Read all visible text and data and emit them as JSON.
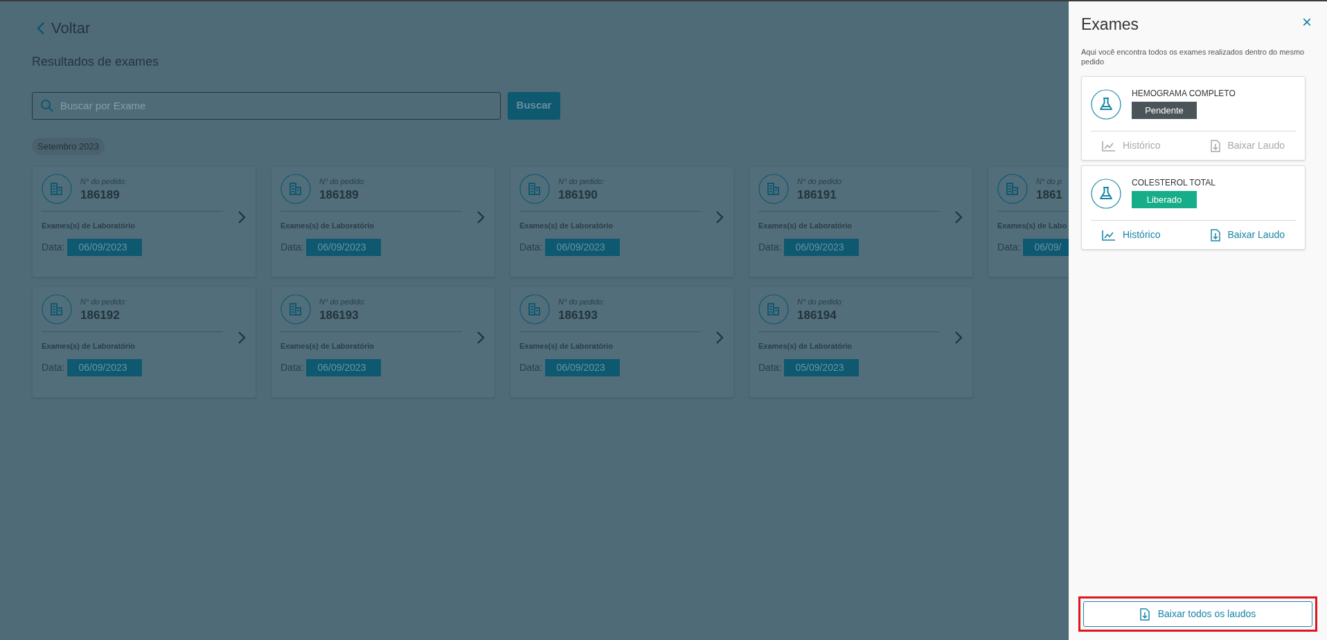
{
  "back_link": {
    "label": "Voltar"
  },
  "page_title": "Resultados de exames",
  "search": {
    "placeholder": "Buscar por Exame",
    "button": "Buscar"
  },
  "month_chip": "Setembro 2023",
  "orders": [
    {
      "number_label": "N° do pedido:",
      "number": "186189",
      "type": "Exames(s) de Laboratório",
      "date_label": "Data:",
      "date": "06/09/2023"
    },
    {
      "number_label": "N° do pedido:",
      "number": "186189",
      "type": "Exames(s) de Laboratório",
      "date_label": "Data:",
      "date": "06/09/2023"
    },
    {
      "number_label": "N° do pedido:",
      "number": "186190",
      "type": "Exames(s) de Laboratório",
      "date_label": "Data:",
      "date": "06/09/2023"
    },
    {
      "number_label": "N° do pedido:",
      "number": "186191",
      "type": "Exames(s) de Laboratório",
      "date_label": "Data:",
      "date": "06/09/2023"
    },
    {
      "number_label": "N° do p",
      "number": "1861",
      "type": "Exames(s) de Labo",
      "date_label": "Data:",
      "date": "06/09/"
    },
    {
      "number_label": "N° do pedido:",
      "number": "186192",
      "type": "Exames(s) de Laboratório",
      "date_label": "Data:",
      "date": "06/09/2023"
    },
    {
      "number_label": "N° do pedido:",
      "number": "186193",
      "type": "Exames(s) de Laboratório",
      "date_label": "Data:",
      "date": "06/09/2023"
    },
    {
      "number_label": "N° do pedido:",
      "number": "186193",
      "type": "Exames(s) de Laboratório",
      "date_label": "Data:",
      "date": "06/09/2023"
    },
    {
      "number_label": "N° do pedido:",
      "number": "186194",
      "type": "Exames(s) de Laboratório",
      "date_label": "Data:",
      "date": "05/09/2023"
    }
  ],
  "panel": {
    "title": "Exames",
    "close": "×",
    "description": "Aqui você encontra todos os exames realizados dentro do mesmo pedido",
    "exams": [
      {
        "name": "HEMOGRAMA COMPLETO",
        "status": {
          "kind": "pending",
          "label": "Pendente"
        },
        "history": "Histórico",
        "download": "Baixar Laudo",
        "disabled": true
      },
      {
        "name": "COLESTEROL TOTAL",
        "status": {
          "kind": "released",
          "label": "Liberado"
        },
        "history": "Histórico",
        "download": "Baixar Laudo",
        "disabled": false
      }
    ],
    "download_all": {
      "label": "Baixar todos os laudos",
      "highlighted": true
    }
  }
}
